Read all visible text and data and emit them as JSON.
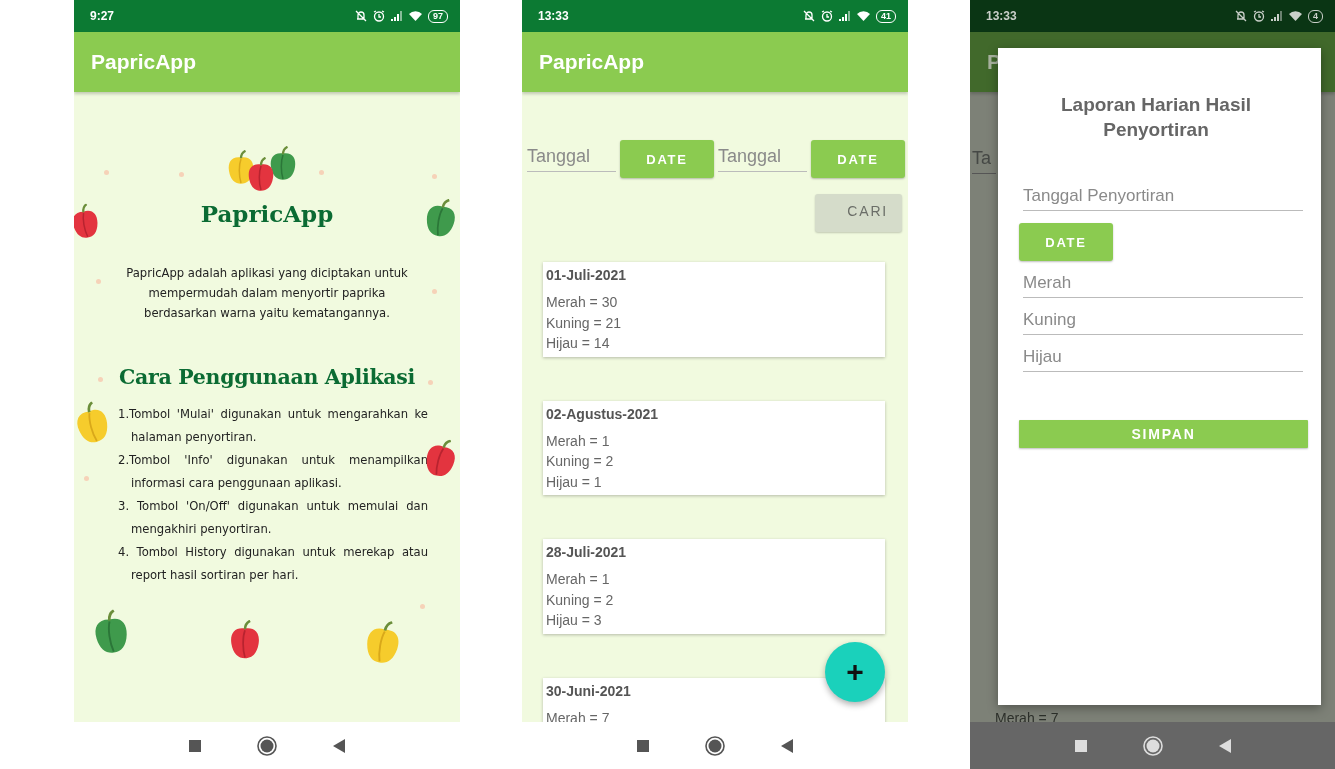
{
  "screens": [
    {
      "kind": "info",
      "status_bar": {
        "time": "9:27",
        "battery": "97"
      },
      "app_bar": {
        "title": "PapricApp"
      },
      "logo_title": "PapricApp",
      "description": "PapricApp adalah aplikasi yang diciptakan untuk mempermudah dalam menyortir paprika berdasarkan warna yaitu kematangannya.",
      "section_title": "Cara Penggunaan Aplikasi",
      "steps": [
        "1.Tombol 'Mulai' digunakan untuk mengarahkan ke halaman penyortiran.",
        "2.Tombol 'Info' digunakan untuk menampilkan informasi cara penggunaan aplikasi.",
        "3. Tombol 'On/Off' digunakan untuk memulai dan mengakhiri penyortiran.",
        "4. Tombol History digunakan untuk merekap atau report hasil sortiran per hari."
      ]
    },
    {
      "kind": "history",
      "status_bar": {
        "time": "13:33",
        "battery": "41"
      },
      "app_bar": {
        "title": "PapricApp"
      },
      "date_filters": [
        {
          "placeholder": "Tanggal",
          "button": "DATE"
        },
        {
          "placeholder": "Tanggal",
          "button": "DATE"
        }
      ],
      "search_button": "CARI",
      "records": [
        {
          "date": "01-Juli-2021",
          "lines": [
            "Merah = 30",
            "Kuning = 21",
            "Hijau = 14"
          ]
        },
        {
          "date": "02-Agustus-2021",
          "lines": [
            "Merah = 1",
            "Kuning = 2",
            "Hijau = 1"
          ]
        },
        {
          "date": "28-Juli-2021",
          "lines": [
            "Merah = 1",
            "Kuning = 2",
            "Hijau = 3"
          ]
        },
        {
          "date": "30-Juni-2021",
          "lines": [
            "Merah = 7"
          ]
        }
      ],
      "fab": "+"
    },
    {
      "kind": "dialog",
      "status_bar": {
        "time": "13:33",
        "battery": "4"
      },
      "background": {
        "app_title": "P",
        "date_field": "Ta",
        "row": "Merah = 7"
      },
      "dialog": {
        "title": "Laporan Harian Hasil Penyortiran",
        "items": [
          {
            "kind": "field",
            "placeholder": "Tanggal Penyortiran"
          },
          {
            "kind": "button",
            "label": "DATE"
          },
          {
            "kind": "field",
            "placeholder": "Merah"
          },
          {
            "kind": "field",
            "placeholder": "Kuning"
          },
          {
            "kind": "field",
            "placeholder": "Hijau"
          }
        ],
        "save_button": "SIMPAN"
      }
    }
  ]
}
